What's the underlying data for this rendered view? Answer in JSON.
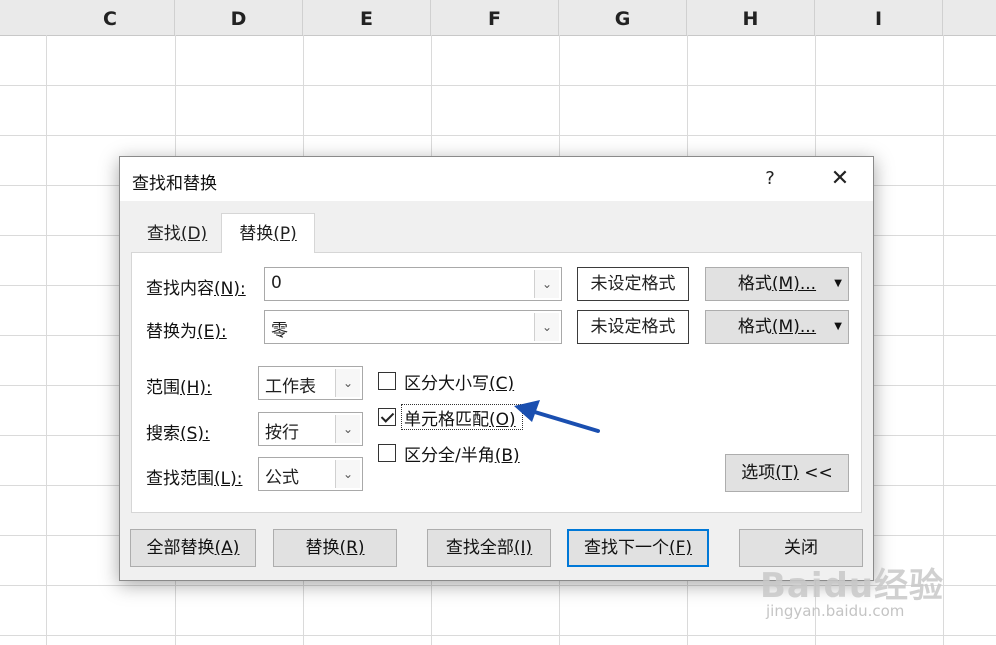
{
  "spreadsheet": {
    "columns": [
      "C",
      "D",
      "E",
      "F",
      "G",
      "H",
      "I"
    ]
  },
  "dialog": {
    "title": "查找和替换",
    "help_label": "?",
    "close_label": "✕",
    "tabs": {
      "find": {
        "text": "查找",
        "key": "(D)"
      },
      "replace": {
        "text": "替换",
        "key": "(P)"
      }
    },
    "find_what": {
      "label": "查找内容",
      "key": "(N):",
      "value": "0"
    },
    "replace_with": {
      "label": "替换为",
      "key": "(E):",
      "value": "零"
    },
    "format_preview_find": "未设定格式",
    "format_preview_replace": "未设定格式",
    "format_button": {
      "text": "格式",
      "key": "(M)..."
    },
    "within": {
      "label": "范围",
      "key": "(H):",
      "value": "工作表"
    },
    "search": {
      "label": "搜索",
      "key": "(S):",
      "value": "按行"
    },
    "look_in": {
      "label": "查找范围",
      "key": "(L):",
      "value": "公式"
    },
    "options": {
      "match_case": {
        "text": "区分大小写",
        "key": "(C)",
        "checked": false
      },
      "match_entire_cell": {
        "text": "单元格匹配",
        "key": "(O)",
        "checked": true
      },
      "match_byte": {
        "text": "区分全/半角",
        "key": "(B)",
        "checked": false
      }
    },
    "options_button": {
      "text": "选项",
      "key": "(T)",
      "suffix": " <<"
    },
    "buttons": {
      "replace_all": {
        "text": "全部替换",
        "key": "(A)"
      },
      "replace": {
        "text": "替换",
        "key": "(R)"
      },
      "find_all": {
        "text": "查找全部",
        "key": "(I)"
      },
      "find_next": {
        "text": "查找下一个",
        "key": "(F)"
      },
      "close": "关闭"
    }
  },
  "annotation_color": "#1a4fb0",
  "watermark": {
    "brand": "Baidu经验",
    "url": "jingyan.baidu.com"
  }
}
